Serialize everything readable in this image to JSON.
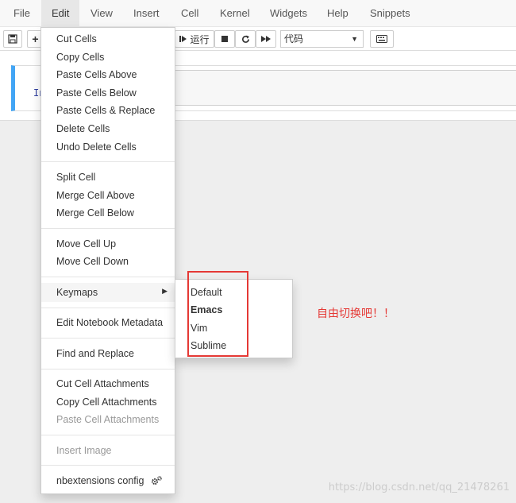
{
  "menubar": {
    "items": [
      "File",
      "Edit",
      "View",
      "Insert",
      "Cell",
      "Kernel",
      "Widgets",
      "Help",
      "Snippets"
    ]
  },
  "toolbar": {
    "run_label": "运行",
    "cell_type": "代码"
  },
  "cell": {
    "prompt": "In"
  },
  "edit_menu": {
    "cut_cells": "Cut Cells",
    "copy_cells": "Copy Cells",
    "paste_above": "Paste Cells Above",
    "paste_below": "Paste Cells Below",
    "paste_replace": "Paste Cells & Replace",
    "delete_cells": "Delete Cells",
    "undo_delete": "Undo Delete Cells",
    "split_cell": "Split Cell",
    "merge_above": "Merge Cell Above",
    "merge_below": "Merge Cell Below",
    "move_up": "Move Cell Up",
    "move_down": "Move Cell Down",
    "keymaps": "Keymaps",
    "edit_metadata": "Edit Notebook Metadata",
    "find_replace": "Find and Replace",
    "cut_attachments": "Cut Cell Attachments",
    "copy_attachments": "Copy Cell Attachments",
    "paste_attachments": "Paste Cell Attachments",
    "insert_image": "Insert Image",
    "nbextensions_config": "nbextensions config"
  },
  "keymaps_submenu": {
    "default": "Default",
    "emacs": "Emacs",
    "vim": "Vim",
    "sublime": "Sublime"
  },
  "annotation": "自由切换吧！！",
  "watermark": "https://blog.csdn.net/qq_21478261",
  "colors": {
    "annotation": "#e53935",
    "cell_border": "#42a5f5"
  }
}
